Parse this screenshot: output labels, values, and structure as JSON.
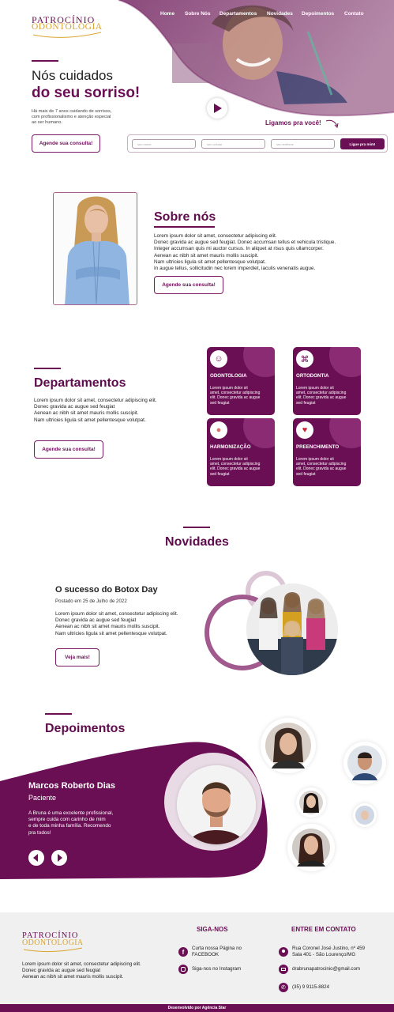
{
  "brand": {
    "name_top": "PATROCÍNIO",
    "name_bottom": "ODONTOLOGIA"
  },
  "nav": [
    "Home",
    "Sobre Nós",
    "Departamentos",
    "Novidades",
    "Depoimentos",
    "Contato"
  ],
  "hero": {
    "title_line1": "Nós cuidados",
    "title_line2": "do seu sorriso!",
    "description": "Há mais de 7 anos cuidando de sorrisos,\ncom profissionalismo e atenção especial\nao ser humano.",
    "cta": "Agende sua consulta!",
    "callback_title": "Ligamos pra você!",
    "callback_fields": [
      "seu nome",
      "seu celular",
      "seu telefone"
    ],
    "callback_button": "Ligue pra mim!"
  },
  "about": {
    "title": "Sobre nós",
    "text": "Lorem ipsum dolor sit amet, consectetur adipiscing elit.\nDonec gravida ac augue sed feugiat. Donec accumsan tellus et vehicula tristique.\nInteger accumsan quis mi auctor cursus. In aliquet at risus quis ullamcorper.\nAenean ac nibh sit amet mauris mollis suscipit.\nNam ultricies ligula sit amet pellentesque volutpat.\nIn augue tellus, sollicitudin nec lorem imperdiet, iaculis venenatis augue.",
    "cta": "Agende sua consulta!"
  },
  "departments": {
    "title": "Departamentos",
    "text": "Lorem ipsum dolor sit amet, consectetur adipiscing elit.\nDonec gravida ac augue sed feugiat\nAenean ac nibh sit amet mauris mollis suscipit.\nNam ultricies ligula sit amet pellentesque volutpat.",
    "cta": "Agende sua consulta!",
    "cards": [
      {
        "title": "ODONTOLOGIA",
        "icon": "tooth-icon",
        "text": "Lorem ipsum dolor sit\namet, consectetur adipiscing\nelit. Donec gravida ac augue\nsed feugiat"
      },
      {
        "title": "ORTODONTIA",
        "icon": "braces-icon",
        "text": "Lorem ipsum dolor sit\namet, consectetur adipiscing\nelit. Donec gravida ac augue\nsed feugiat"
      },
      {
        "title": "HARMONIZAÇÃO",
        "icon": "face-icon",
        "text": "Lorem ipsum dolor sit\namet, consectetur adipiscing\nelit. Donec gravida ac augue\nsed feugiat"
      },
      {
        "title": "PREENCHIMENTO",
        "icon": "lips-icon",
        "text": "Lorem ipsum dolor sit\namet, consectetur adipiscing\nelit. Donec gravida ac augue\nsed feugiat"
      }
    ]
  },
  "news": {
    "section_title": "Novidades",
    "post_title": "O sucesso do Botox Day",
    "post_date": "Postado em 25 de Julho de 2022",
    "post_text": "Lorem ipsum dolor sit amet, consectetur adipiscing elit.\nDonec gravida ac augue sed feugiat\nAenean ac nibh sit amet mauris mollis suscipit.\nNam ultricies ligula sit amet pellentesque volutpat.",
    "cta": "Veja mais!"
  },
  "testimonials": {
    "title": "Depoimentos",
    "name": "Marcos Roberto Dias",
    "role": "Paciente",
    "quote": "A Bruna é uma excelente profissional,\nsempre cuida com carinho de mim\ne de toda minha família. Recomendo\npra todos!"
  },
  "footer": {
    "about": "Lorem ipsum dolor sit amet, consectetur adipiscing elit.\nDonec gravida ac augue sed feugiat\nAenean ac nibh sit amet mauris mollis suscipit.",
    "follow_title": "SIGA-NOS",
    "facebook": "Curta nossa Página no\nFACEBOOK",
    "instagram": "Siga-nos no Instagram",
    "contact_title": "ENTRE EM CONTATO",
    "address": "Rua Coronel José Justino, nº 459\nSala 401 - São Lourenço/MG",
    "email": "drabrunapatrocinio@gmail.com",
    "phone": "(35) 9 9115-8824",
    "credits": "Desenvolvido por Agência Star"
  },
  "colors": {
    "primary": "#6b0f55",
    "secondary": "#a15a8e",
    "accent": "#e8b23a"
  }
}
